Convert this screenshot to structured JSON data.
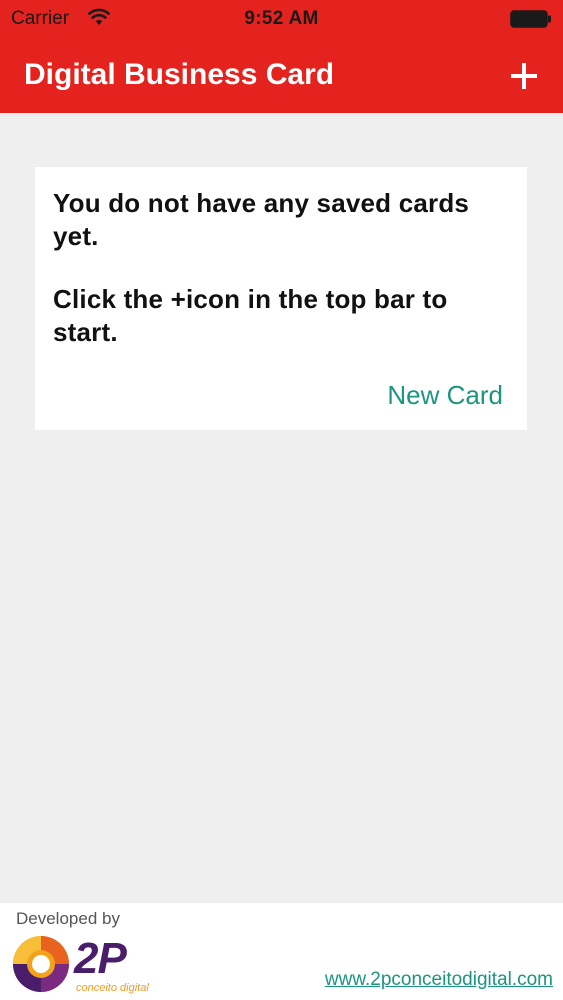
{
  "status_bar": {
    "carrier": "Carrier",
    "time": "9:52 AM",
    "wifi_icon": "wifi-icon",
    "battery_icon": "battery-icon"
  },
  "nav_bar": {
    "title": "Digital Business Card",
    "add_icon": "plus-icon",
    "background_color": "#e4231f"
  },
  "empty_card": {
    "message_1": "You do not have any saved cards yet.",
    "message_2": "Click the +icon in the top bar to start.",
    "new_card_label": "New Card",
    "accent_color": "#1b9580"
  },
  "footer": {
    "developed_by": "Developed by",
    "logo_text": "2P",
    "logo_tagline": "conceito digital",
    "website": "www.2pconceitodigital.com"
  }
}
